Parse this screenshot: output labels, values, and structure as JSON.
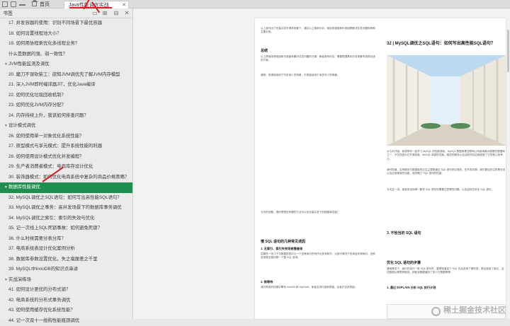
{
  "tabs": {
    "home_label": "首页",
    "doc_label": "Java性能调优实战"
  },
  "sidebar": {
    "title": "书签",
    "items": [
      {
        "label": "17. 并发容器的使用：识别不同场景下最优容器",
        "level": 2
      },
      {
        "label": "18. 如何设置线程池大小？",
        "level": 2
      },
      {
        "label": "19. 如何用协程来优化多线程业务？",
        "level": 2
      },
      {
        "label": "什么是数据的强、弱一致性？",
        "level": 2
      },
      {
        "label": "JVM性能监测及调优",
        "level": 1,
        "expanded": true
      },
      {
        "label": "20. 磨刀不误砍柴工：欲知JVM调优先了解JVM内存模型",
        "level": 2
      },
      {
        "label": "21. 深入JVM即时编译器JIT，优化Java编译",
        "level": 2
      },
      {
        "label": "22. 如何优化垃圾回收机制？",
        "level": 2
      },
      {
        "label": "23. 如何优化JVM内存分配？",
        "level": 2
      },
      {
        "label": "24. 内存持续上升，我该如何排查问题？",
        "level": 2
      },
      {
        "label": "设计模式调优",
        "level": 1,
        "expanded": true
      },
      {
        "label": "26. 如何使用单一对象优化系统性能？",
        "level": 2
      },
      {
        "label": "27. 原型模式与享元模式：提升系统性能的利器",
        "level": 2
      },
      {
        "label": "28. 如何使用设计模式优化并发编程？",
        "level": 2
      },
      {
        "label": "29. 生产者消费者模式：电商库存设计优化",
        "level": 2
      },
      {
        "label": "30. 装饰器模式：如何优化电商系统中复杂的商品价格策略？",
        "level": 2
      },
      {
        "label": "数据库性能调优",
        "level": 1,
        "expanded": true,
        "selected": true
      },
      {
        "label": "32. MySQL调优之SQL语句：如何写出高性能SQL语句？",
        "level": 2
      },
      {
        "label": "33. MySQL调优之事务：高并发场景下的数据库事务调优",
        "level": 2
      },
      {
        "label": "34. MySQL调优之索引：索引的失效与优化",
        "level": 2
      },
      {
        "label": "35. 记一次线上SQL死锁事故：如何避免死锁？",
        "level": 2
      },
      {
        "label": "36. 什么时候需要分表分库？",
        "level": 2
      },
      {
        "label": "37. 电商系统表设计优化案例分析",
        "level": 2
      },
      {
        "label": "38. 数据库参数设置优化，失之毫厘差之千里",
        "level": 2
      },
      {
        "label": "39. MySQL中InnoDB的知识点串讲",
        "level": 2
      },
      {
        "label": "实战演练场",
        "level": 1,
        "expanded": true
      },
      {
        "label": "41. 如何设计更优的分布式锁？",
        "level": 2
      },
      {
        "label": "42. 电商系统的分布式事务调优",
        "level": 2
      },
      {
        "label": "43. 如何使用缓存优化系统性能？",
        "level": 2
      },
      {
        "label": "44. 记一次双十一抢购性能瓶颈调优",
        "level": 2
      }
    ]
  },
  "document": {
    "left_col": {
      "para1": "以上我列出了在高并发写请求场景下，通过以上案例分析，使用悲观锁和乐观锁是解决并发问题的两种主要手段。",
      "summary_title": "总结",
      "para2": "以上是使用悲观锁和乐观锁来解决并发问题的方案，两者各有优劣，需要根据具体业务场景来选择合适的方案。",
      "para3": "通常，悲观锁适用于写多读少的场景，乐观锁适用于读多写少的场景。",
      "para4": "今天的问题，请你想想还有哪些方法可以优化高并发下的数据库性能？",
      "section_title": "慢 SQL 语句的几种常见诱因",
      "sub1": "1. 无索引、索引失效导致慢查询",
      "sub2": "2. 锁等待",
      "para5": "如果在一张几千万数据的表中以一个没有索引的列作为查询条件，大部分情况下查询会非常耗时，这种查询毫无疑问是一个慢 SQL 查询。",
      "para6": "我们常用的存储引擎有 InnoDB 和 MyISAM，前者支持行锁和表锁，后者只支持表锁。"
    },
    "right_col": {
      "title": "32 | MySQL调优之SQL语句：如何写出高性能SQL语句？",
      "para1": "从今天开始，我将带你一起学习 MySQL 的性能调优。MySQL 数据库是互联网公司使用最为频繁的数据库之一，不仅仅因为它开源免费，MySQL 卓越的性能、稳定的服务以及活跃的社区都成就了它的核心竞争力。",
      "para2": "我们知道，应用服务与数据库的交互主要是通过 SQL 语句来实现的。在开发初期，我们更加关注的是业务以及应用程序的功能，而忽略了 SQL 语句的性能。",
      "para3": "今天这一讲，我就来给你聊一聊写 SQL 语句时需要注意哪些问题，以及如何去优化 SQL 语句。",
      "sec1": "3. 不恰当的 SQL 语句",
      "sec2": "优化 SQL 语句的步骤",
      "sec3": "1. 通过 EXPLAIN 分析 SQL 执行计划",
      "para4": "通常情况下，我们在执行一条 SQL 语句时，要想知道这个 SQL 先后查询了哪些表，是否使用了索引，这些数据从哪里获取到，获取到数据遍历了多少行数据等等。"
    },
    "watermark": "稀土掘金技术社区"
  }
}
